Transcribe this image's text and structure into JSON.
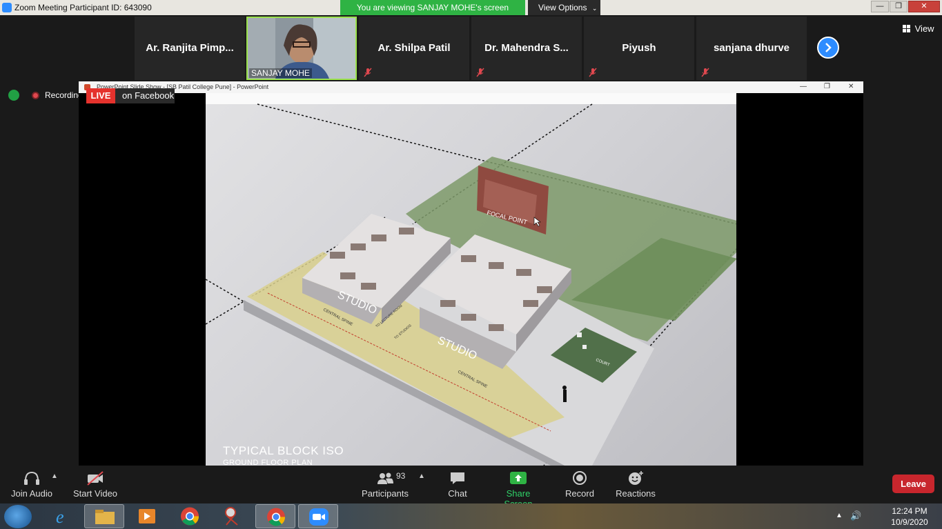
{
  "titlebar": {
    "title": "Zoom Meeting Participant ID: 643090",
    "viewing_banner": "You are viewing SANJAY MOHE's screen",
    "view_options": "View Options",
    "minimize": "—",
    "restore": "❐",
    "close": "✕"
  },
  "participants": [
    {
      "name": "Ar. Ranjita Pimp..."
    },
    {
      "name": "SANJAY MOHE"
    },
    {
      "name": "Ar. Shilpa Patil"
    },
    {
      "name": "Dr. Mahendra S..."
    },
    {
      "name": "Piyush"
    },
    {
      "name": "sanjana dhurve"
    }
  ],
  "view_label": "View",
  "status": {
    "recording": "Recording",
    "live": "LIVE",
    "live_destination": "on Facebook"
  },
  "shared_window": {
    "title": "PowerPoint Slide Show - [SB Patil College Pune] - PowerPoint",
    "minimize": "—",
    "restore": "❐",
    "close": "✕"
  },
  "slide": {
    "title": "TYPICAL BLOCK ISO",
    "subtitle": "GROUND FLOOR PLAN",
    "labels": {
      "focal_point": "FOCAL POINT",
      "studio_left": "STUDIO",
      "studio_right": "STUDIO",
      "spine_left": "CENTRAL SPINE",
      "spine_right": "CENTRAL SPINE",
      "lecture_room": "TO LECTURE ROOM",
      "to_studios": "TO STUDIOS",
      "court": "COURT"
    }
  },
  "toolbar": {
    "join_audio": "Join Audio",
    "start_video": "Start Video",
    "participants": "Participants",
    "participant_count": "93",
    "chat": "Chat",
    "share_screen": "Share Screen",
    "record": "Record",
    "reactions": "Reactions",
    "leave": "Leave"
  },
  "taskbar": {
    "time": "12:24 PM",
    "date": "10/9/2020"
  },
  "colors": {
    "zoom_blue": "#2d8cff",
    "share_green": "#2fb344",
    "leave_red": "#c8262d",
    "live_red": "#e5322d",
    "video_border": "#9be34b"
  }
}
